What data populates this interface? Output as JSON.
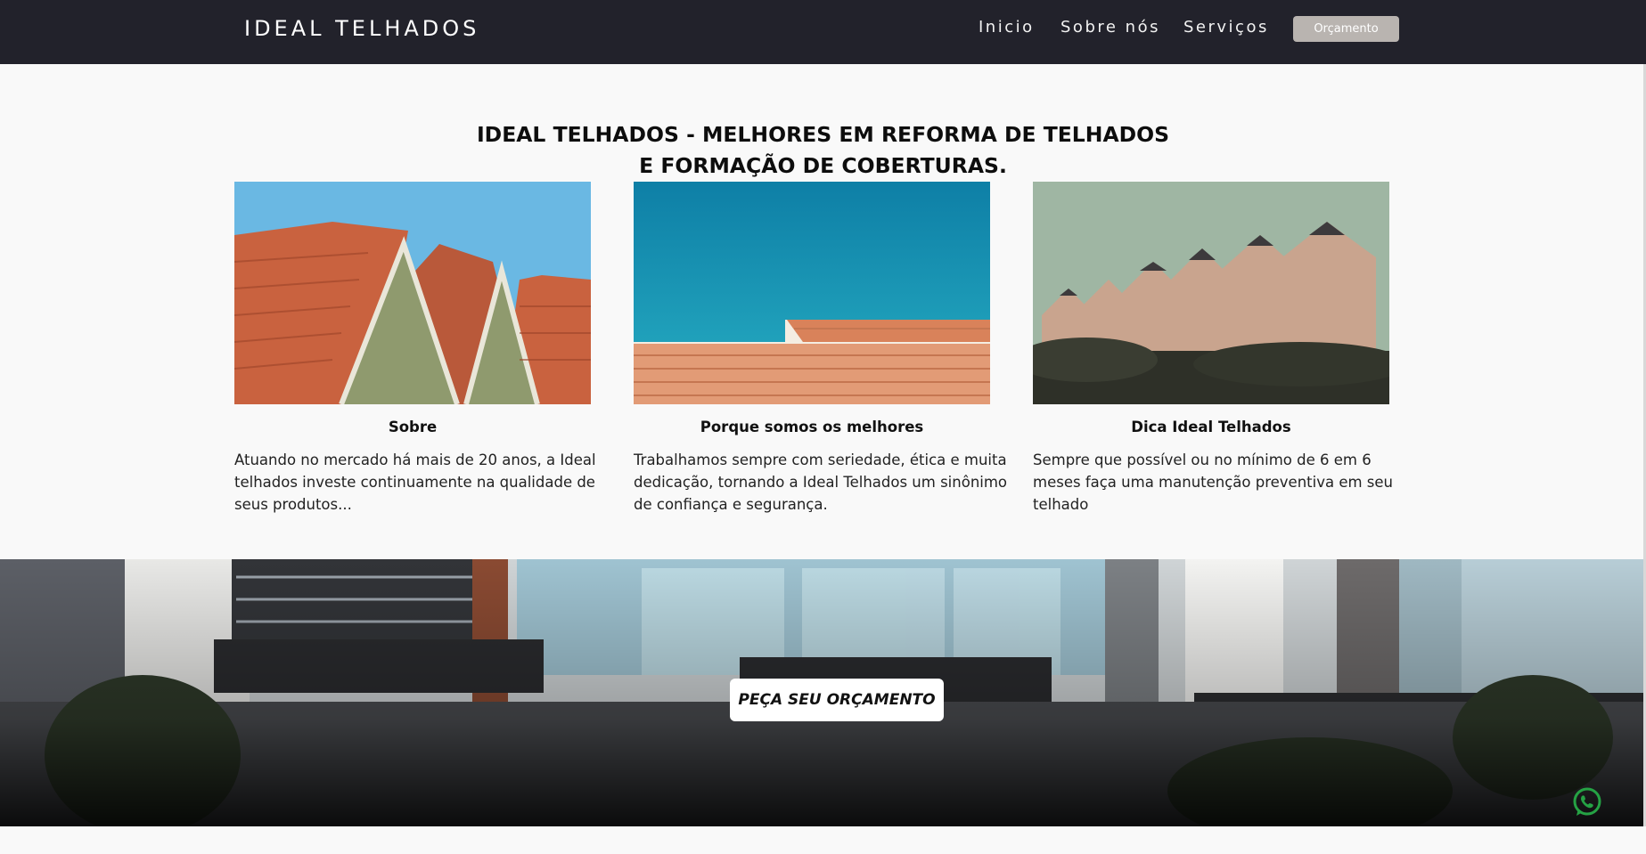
{
  "nav": {
    "brand": "IDEAL TELHADOS",
    "links": [
      "Inicio",
      "Sobre nós",
      "Serviços"
    ],
    "cta": "Orçamento"
  },
  "hero": {
    "line1": "IDEAL TELHADOS - MELHORES EM REFORMA DE TELHADOS",
    "line2": "E FORMAÇÃO DE COBERTURAS."
  },
  "cards": [
    {
      "title": "Sobre",
      "text": "Atuando no mercado há mais de 20 anos, a Ideal telhados investe continuamente na qualidade de seus produtos..."
    },
    {
      "title": "Porque somos os melhores",
      "text": "Trabalhamos sempre com seriedade, ética e muita dedicação, tornando a Ideal Telhados um sinônimo de confiança e segurança."
    },
    {
      "title": "Dica Ideal Telhados",
      "text": "Sempre que possível ou no mínimo de 6 em 6 meses faça uma manutenção preventiva em seu telhado"
    }
  ],
  "banner": {
    "cta": "PEÇA SEU ORÇAMENTO"
  },
  "colors": {
    "nav_bg": "#22222b",
    "button_gray": "#b9b4b0",
    "whatsapp_green": "#25a244"
  },
  "icons": {
    "whatsapp": "whatsapp-icon"
  }
}
